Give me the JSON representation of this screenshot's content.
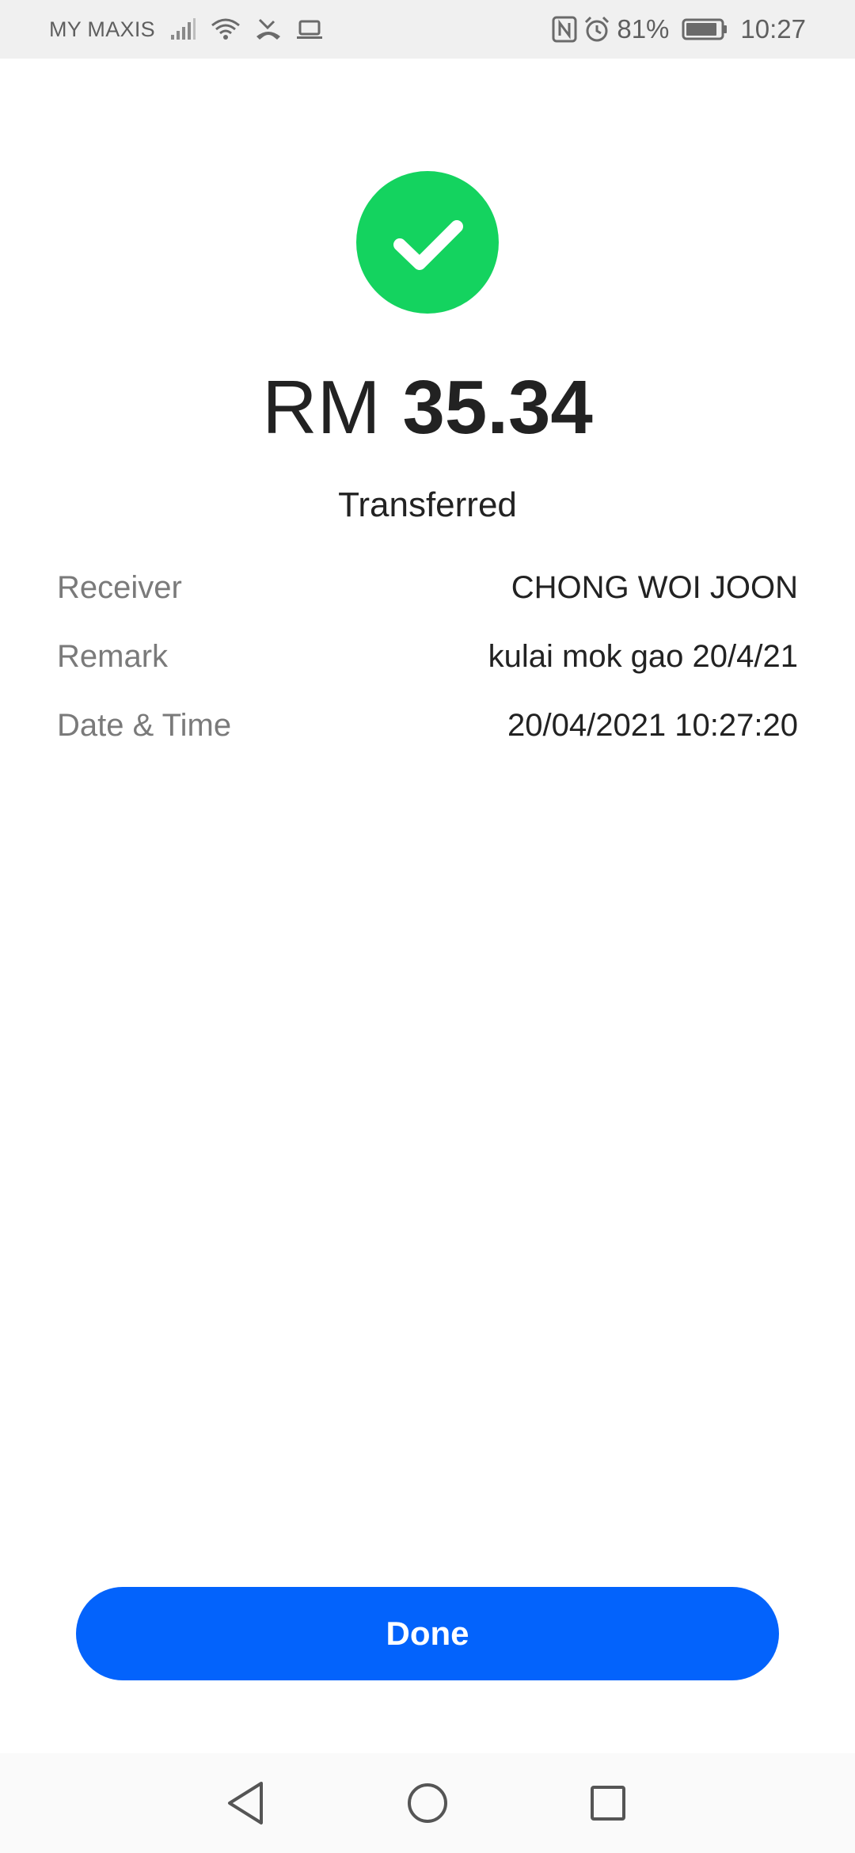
{
  "status_bar": {
    "carrier": "MY MAXIS",
    "battery": "81%",
    "time": "10:27",
    "icons": [
      "signal-icon",
      "wifi-icon",
      "missed-call-icon",
      "laptop-icon",
      "nfc-icon",
      "alarm-icon",
      "battery-icon"
    ]
  },
  "success": {
    "icon": "checkmark-icon",
    "color": "#14d35f"
  },
  "amount": {
    "currency": "RM",
    "value": "35.34"
  },
  "status_text": "Transferred",
  "details": [
    {
      "label": "Receiver",
      "value": "CHONG WOI JOON"
    },
    {
      "label": "Remark",
      "value": "kulai mok gao 20/4/21"
    },
    {
      "label": "Date & Time",
      "value": "20/04/2021 10:27:20"
    }
  ],
  "done_button": {
    "label": "Done",
    "color": "#0363fc"
  },
  "nav_bar": {
    "buttons": [
      "back-icon",
      "home-icon",
      "recent-apps-icon"
    ]
  }
}
